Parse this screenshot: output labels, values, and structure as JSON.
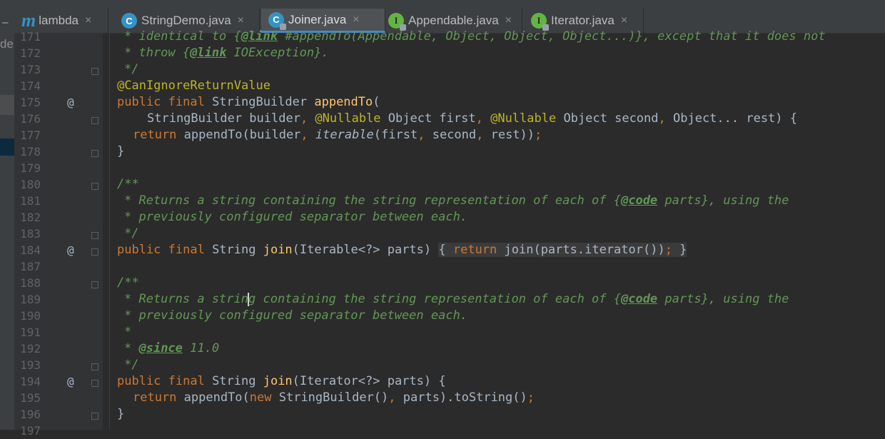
{
  "left_panel": {
    "label": "de",
    "dash": "–"
  },
  "tabs": [
    {
      "icon": "method-icon",
      "letter": "m",
      "label": "lambda",
      "close": "×"
    },
    {
      "icon": "class-icon",
      "letter": "C",
      "label": "StringDemo.java",
      "close": "×"
    },
    {
      "icon": "class-icon",
      "letter": "C",
      "label": "Joiner.java",
      "close": "×",
      "active": true
    },
    {
      "icon": "interface-icon",
      "letter": "I",
      "label": "Appendable.java",
      "close": "×"
    },
    {
      "icon": "interface-icon",
      "letter": "I",
      "label": "Iterator.java",
      "close": "×"
    }
  ],
  "line_numbers": [
    "171",
    "172",
    "173",
    "174",
    "175",
    "176",
    "177",
    "178",
    "179",
    "180",
    "181",
    "182",
    "183",
    "184",
    "187",
    "188",
    "189",
    "190",
    "191",
    "192",
    "193",
    "194",
    "195",
    "196",
    "197"
  ],
  "gutter_at": "@",
  "code": {
    "l171": [
      "* identical to {",
      "@link",
      " #appendTo(Appendable, Object, Object, Object...)}, except that it does not"
    ],
    "l172": [
      "* throw {",
      "@link",
      " IOException}."
    ],
    "l173": "*/",
    "l174": "@CanIgnoreReturnValue",
    "l175": [
      "public final ",
      "StringBuilder ",
      "appendTo",
      "("
    ],
    "l176": [
      "StringBuilder builder",
      ", ",
      "@Nullable",
      " Object first",
      ", ",
      "@Nullable",
      " Object second",
      ", ",
      "Object... rest) {"
    ],
    "l177": [
      "return ",
      "appendTo(builder",
      ", ",
      "iterable",
      "(first",
      ", ",
      "second",
      ", ",
      "rest))",
      ";"
    ],
    "l178": "}",
    "l180": "/**",
    "l181": [
      "* Returns a string containing the string representation of each of {",
      "@code",
      " parts}, using the"
    ],
    "l182": "* previously configured separator between each.",
    "l183": "*/",
    "l184": [
      "public final ",
      "String ",
      "join",
      "(Iterable<?> parts) ",
      "{ ",
      "return ",
      "join(parts.iterator())",
      ";",
      " }"
    ],
    "l188": "/**",
    "l189a": "* Returns a strin",
    "l189b": "g containing the string representation of each of {",
    "l189c": "@code",
    "l189d": " parts}, using the",
    "l190": "* previously configured separator between each.",
    "l191": "*",
    "l192": [
      "* ",
      "@since",
      " 11.0"
    ],
    "l193": "*/",
    "l194": [
      "public final ",
      "String ",
      "join",
      "(Iterator<?> parts) {"
    ],
    "l195": [
      "return ",
      "appendTo(",
      "new ",
      "StringBuilder()",
      ", ",
      "parts).toString()",
      ";"
    ],
    "l196": "}"
  }
}
